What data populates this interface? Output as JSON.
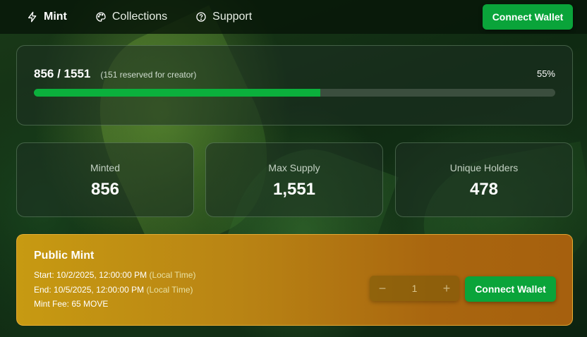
{
  "nav": {
    "items": [
      {
        "label": "Mint",
        "icon": "lightning-icon",
        "active": true
      },
      {
        "label": "Collections",
        "icon": "palette-icon",
        "active": false
      },
      {
        "label": "Support",
        "icon": "help-circle-icon",
        "active": false
      }
    ],
    "connect_label": "Connect Wallet"
  },
  "progress": {
    "count": "856 / 1551",
    "note": "(151 reserved for creator)",
    "percent_label": "55%",
    "fraction": 0.55
  },
  "stats": [
    {
      "label": "Minted",
      "value": "856"
    },
    {
      "label": "Max Supply",
      "value": "1,551"
    },
    {
      "label": "Unique Holders",
      "value": "478"
    }
  ],
  "mint": {
    "title": "Public Mint",
    "start_label": "Start: 10/2/2025, 12:00:00 PM",
    "end_label": "End: 10/5/2025, 12:00:00 PM",
    "local_time": "(Local Time)",
    "fee_label": "Mint Fee: 65 MOVE",
    "quantity": "1",
    "minus": "−",
    "plus": "+",
    "connect_label": "Connect Wallet"
  },
  "colors": {
    "accent_green": "#0aa43a",
    "progress_fill": "#0bb03c",
    "mint_card": "#b98414"
  }
}
